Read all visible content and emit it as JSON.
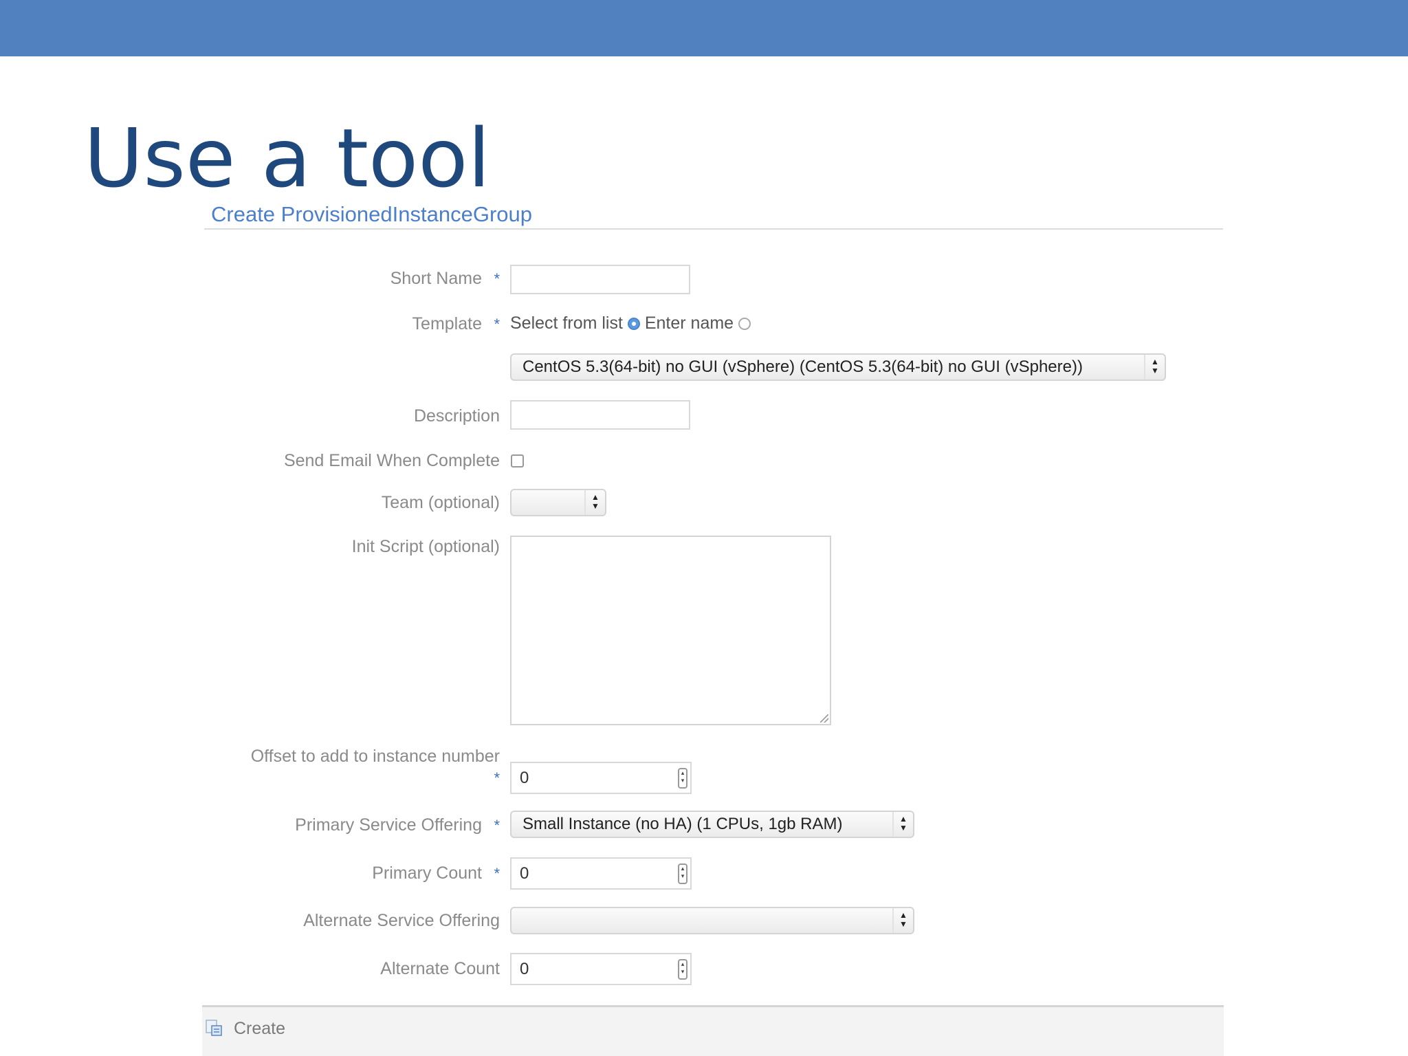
{
  "slide": {
    "title": "Use a tool"
  },
  "form": {
    "heading": "Create ProvisionedInstanceGroup",
    "fields": {
      "short_name": {
        "label": "Short Name",
        "value": ""
      },
      "template": {
        "label": "Template",
        "option_select": "Select from list",
        "option_enter": "Enter name",
        "selected_option": "Select from list",
        "selected_value": "CentOS 5.3(64-bit) no GUI (vSphere) (CentOS 5.3(64-bit) no GUI (vSphere))"
      },
      "description": {
        "label": "Description",
        "value": ""
      },
      "send_email": {
        "label": "Send Email When Complete",
        "checked": false
      },
      "team": {
        "label": "Team (optional)",
        "selected_value": ""
      },
      "init_script": {
        "label": "Init Script (optional)",
        "value": ""
      },
      "offset": {
        "label": "Offset to add to instance number",
        "value": "0"
      },
      "primary_service_offering": {
        "label": "Primary Service Offering",
        "selected_value": "Small Instance (no HA) (1 CPUs, 1gb RAM)"
      },
      "primary_count": {
        "label": "Primary Count",
        "value": "0"
      },
      "alternate_service_offering": {
        "label": "Alternate Service Offering",
        "selected_value": ""
      },
      "alternate_count": {
        "label": "Alternate Count",
        "value": "0"
      }
    },
    "required_marker": "*",
    "footer": {
      "create_label": "Create"
    }
  },
  "colors": {
    "top_bar": "#5181be",
    "slide_title": "#1f497d",
    "form_heading": "#4b7fcb",
    "label_text": "#8a8a8a",
    "required_star": "#3a6fbf"
  },
  "icons": {
    "select_arrows": "up-down-arrows-icon",
    "number_spinner": "spinner-icon",
    "create": "create-document-icon"
  }
}
